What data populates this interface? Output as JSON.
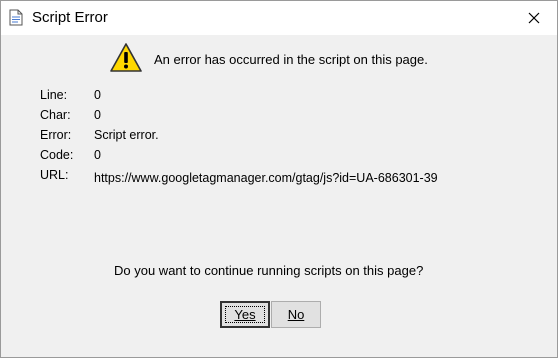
{
  "window": {
    "title": "Script Error",
    "icons": {
      "app": "document-icon",
      "close": "close-icon",
      "warning": "warning-icon"
    }
  },
  "message": "An error has occurred in the script on this page.",
  "details": [
    {
      "label": "Line:",
      "value": "0"
    },
    {
      "label": "Char:",
      "value": "0"
    },
    {
      "label": "Error:",
      "value": "Script error."
    },
    {
      "label": "Code:",
      "value": "0"
    },
    {
      "label": "URL:",
      "value": "https://www.googletagmanager.com/gtag/js?id=UA-686301-39"
    }
  ],
  "question": "Do you want to continue running scripts on this page?",
  "buttons": {
    "yes": "Yes",
    "no": "No"
  }
}
